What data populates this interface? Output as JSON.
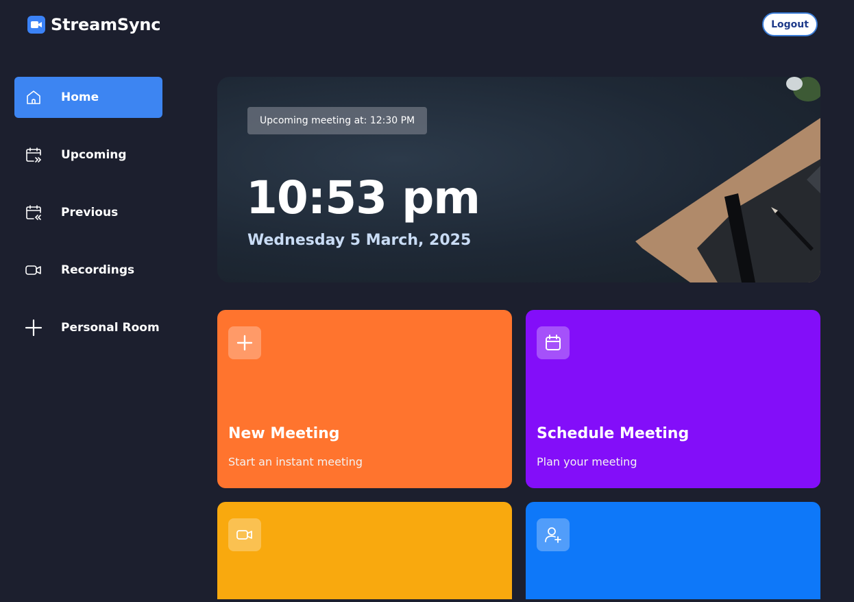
{
  "header": {
    "brand_name": "StreamSync",
    "brand_icon": "video-camera-icon",
    "logout_label": "Logout"
  },
  "sidebar": {
    "items": [
      {
        "label": "Home",
        "icon": "home-icon",
        "active": true
      },
      {
        "label": "Upcoming",
        "icon": "calendar-forward-icon",
        "active": false
      },
      {
        "label": "Previous",
        "icon": "calendar-back-icon",
        "active": false
      },
      {
        "label": "Recordings",
        "icon": "video-icon",
        "active": false
      },
      {
        "label": "Personal Room",
        "icon": "plus-icon",
        "active": false
      }
    ]
  },
  "hero": {
    "upcoming_text": "Upcoming meeting at: 12:30 PM",
    "time": "10:53 pm",
    "date": "Wednesday 5 March, 2025"
  },
  "cards": [
    {
      "title": "New Meeting",
      "subtitle": "Start an instant meeting",
      "icon": "plus-icon",
      "color": "#ff742e"
    },
    {
      "title": "Schedule Meeting",
      "subtitle": "Plan your meeting",
      "icon": "calendar-icon",
      "color": "#830ef9"
    },
    {
      "title": "",
      "subtitle": "",
      "icon": "video-icon",
      "color": "#f9a90e"
    },
    {
      "title": "",
      "subtitle": "",
      "icon": "add-user-icon",
      "color": "#0e78f9"
    }
  ],
  "colors": {
    "background": "#1c1f2e",
    "accent": "#3d85f2"
  }
}
